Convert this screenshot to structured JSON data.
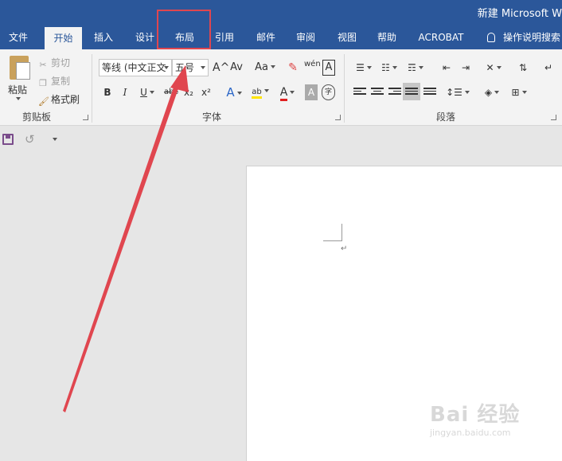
{
  "window": {
    "title": "新建 Microsoft W"
  },
  "tabs": [
    {
      "label": "文件"
    },
    {
      "label": "开始"
    },
    {
      "label": "插入"
    },
    {
      "label": "设计"
    },
    {
      "label": "布局"
    },
    {
      "label": "引用"
    },
    {
      "label": "邮件"
    },
    {
      "label": "审阅"
    },
    {
      "label": "视图"
    },
    {
      "label": "帮助"
    },
    {
      "label": "ACROBAT"
    }
  ],
  "active_tab": "开始",
  "tell_me": {
    "label": "操作说明搜索"
  },
  "clipboard": {
    "group_label": "剪贴板",
    "paste_label": "粘贴",
    "cut_label": "剪切",
    "copy_label": "复制",
    "format_painter_label": "格式刷"
  },
  "font": {
    "group_label": "字体",
    "font_name": "等线 (中文正文",
    "font_size": "五号",
    "grow_icon": "A^",
    "shrink_icon": "Av",
    "case_label": "Aa",
    "phonetic_label": "wén",
    "border_char_label": "A",
    "bold": "B",
    "italic": "I",
    "underline": "U",
    "strike": "abc",
    "subscript": "x₂",
    "superscript": "x²",
    "effects_label": "A",
    "highlight_label": "ab",
    "font_color_label": "A",
    "char_shading_label": "A",
    "enclose_label": "字"
  },
  "paragraph": {
    "group_label": "段落"
  },
  "colors": {
    "title_bar": "#2b579a",
    "ribbon": "#f3f3f3",
    "highlight_box": "#e0464f",
    "arrow": "#e0464f"
  },
  "watermark": {
    "main": "Bai 经验",
    "sub": "jingyan.baidu.com"
  }
}
